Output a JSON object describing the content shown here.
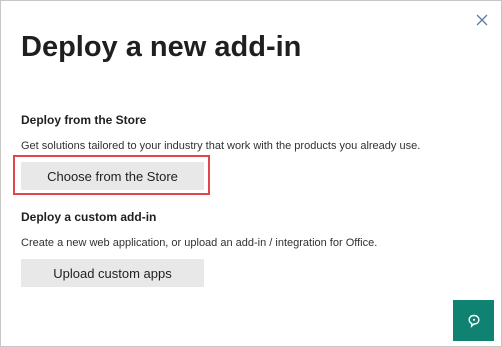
{
  "dialog": {
    "title": "Deploy a new add-in",
    "close_icon": "close-icon",
    "sections": [
      {
        "heading": "Deploy from the Store",
        "description": "Get solutions tailored to your industry that work with the products you already use.",
        "button_label": "Choose from the Store",
        "highlighted": true
      },
      {
        "heading": "Deploy a custom add-in",
        "description": "Create a new web application, or upload an add-in / integration for Office.",
        "button_label": "Upload custom apps",
        "highlighted": false
      }
    ],
    "help_icon": "chat-help-icon"
  },
  "colors": {
    "accent": "#108272",
    "highlight_border": "#e0474c",
    "button_bg": "#e8e8e8"
  }
}
